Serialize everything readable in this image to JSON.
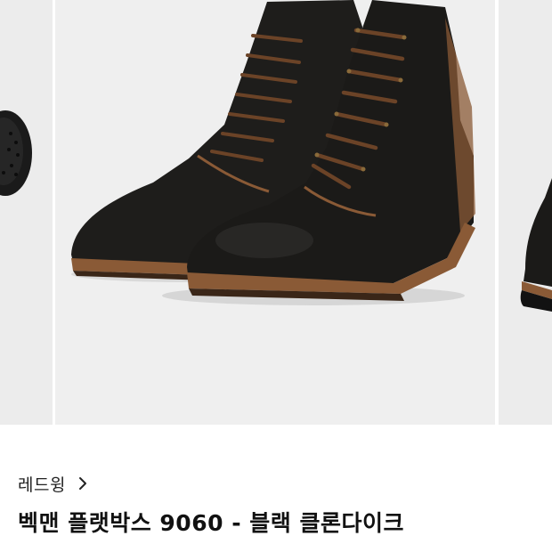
{
  "product": {
    "brand": "레드윙",
    "title": "벡맨 플랫박스 9060 - 블랙 클론다이크"
  },
  "images": {
    "previous": "boot-sole-photo",
    "current": "black-leather-boots-photo",
    "next": "boot-side-photo"
  },
  "icons": {
    "brand_chevron": "chevron-right-icon"
  },
  "colors": {
    "leather": "#1b1a18",
    "laces": "#6b4327",
    "welt": "#8a5a36",
    "photo_background": "#efefef"
  }
}
